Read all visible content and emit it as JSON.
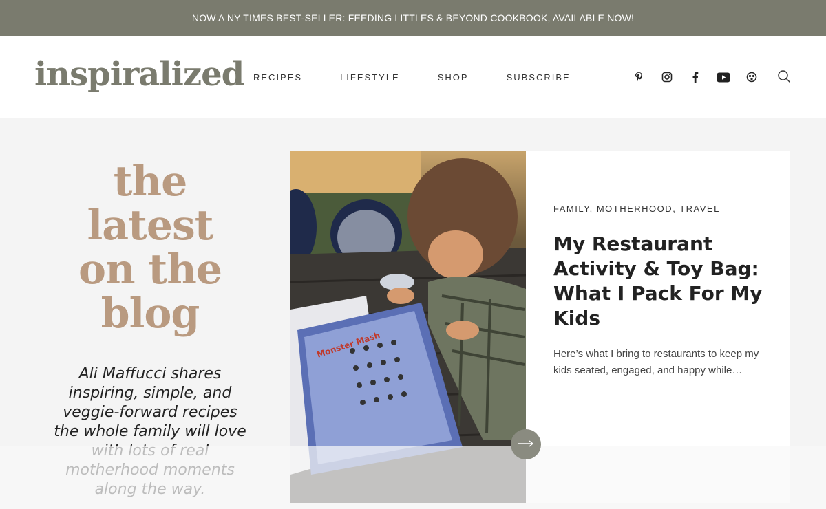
{
  "promo": {
    "text": "NOW A NY TIMES BEST-SELLER: FEEDING LITTLES & BEYOND COOKBOOK, AVAILABLE NOW!"
  },
  "header": {
    "logo": "inspiralized",
    "nav": [
      "RECIPES",
      "LIFESTYLE",
      "SHOP",
      "SUBSCRIBE"
    ],
    "social_icons": [
      "pinterest-icon",
      "instagram-icon",
      "facebook-icon",
      "youtube-icon",
      "other-social-icon"
    ]
  },
  "intro": {
    "title_lines": [
      "the",
      "latest",
      "on the",
      "blog"
    ],
    "text": "Ali Maffucci shares inspiring, simple, and veggie-forward recipes the whole family will love with lots of real motherhood moments along the way."
  },
  "post": {
    "categories": [
      "FAMILY",
      "MOTHERHOOD",
      "TRAVEL"
    ],
    "title": "My Restaurant Activity & Toy Bag: What I Pack For My Kids",
    "excerpt": "Here’s what I bring to restaurants to keep my kids seated, engaged, and happy while…",
    "image_text": "Monster Mash"
  },
  "colors": {
    "promo_bg": "#7a7b6e",
    "logo": "#7a7b6e",
    "accent": "#b99a80"
  }
}
